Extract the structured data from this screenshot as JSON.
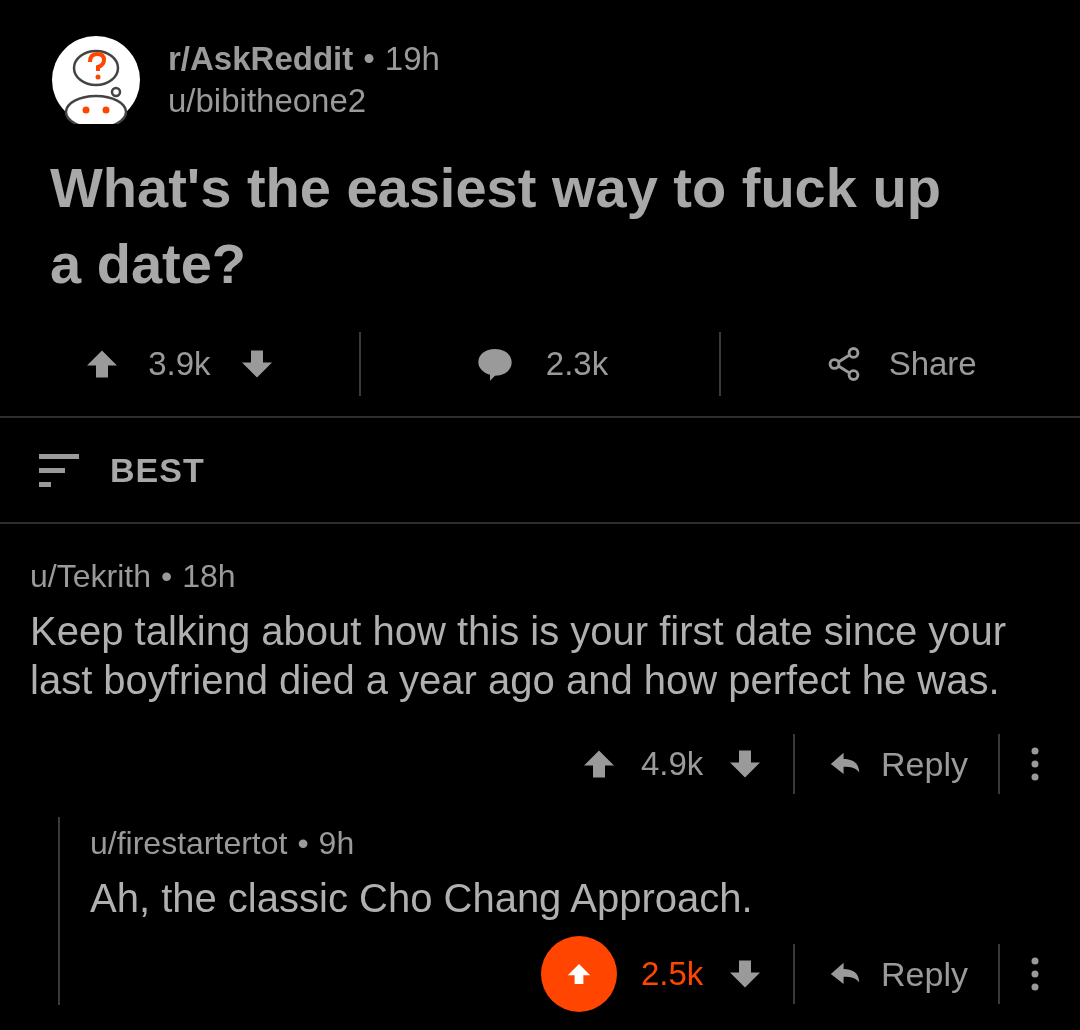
{
  "post": {
    "subreddit": "r/AskReddit",
    "separator": "•",
    "time": "19h",
    "author": "u/bibitheone2",
    "title": "What's the easiest way to fuck up a date?",
    "score": "3.9k",
    "upvoted": false,
    "comments": "2.3k",
    "share": "Share"
  },
  "sort": {
    "label": "BEST"
  },
  "comments": [
    {
      "author": "u/Tekrith",
      "separator": "•",
      "time": "18h",
      "body": "Keep talking about how this is your first date since your last boyfriend died a year ago and how perfect he was.",
      "score": "4.9k",
      "upvoted": false,
      "reply": "Reply",
      "children": [
        {
          "author": "u/firestartertot",
          "separator": "•",
          "time": "9h",
          "body": "Ah, the classic Cho Chang Approach.",
          "score": "2.5k",
          "upvoted": true,
          "reply": "Reply"
        }
      ]
    }
  ]
}
